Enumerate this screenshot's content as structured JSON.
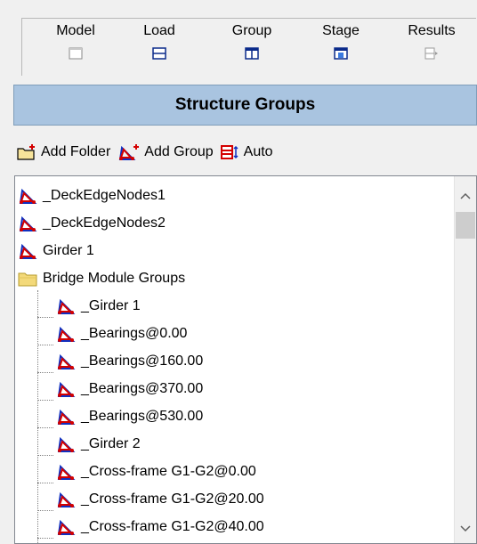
{
  "tabs": [
    {
      "label": "Model"
    },
    {
      "label": "Load"
    },
    {
      "label": "Group"
    },
    {
      "label": "Stage"
    },
    {
      "label": "Results"
    }
  ],
  "header": {
    "title": "Structure Groups"
  },
  "toolbar": {
    "add_folder": "Add Folder",
    "add_group": "Add Group",
    "auto": "Auto"
  },
  "tree": {
    "root_items": [
      "_DeckEdgeNodes1",
      "_DeckEdgeNodes2",
      "Girder 1"
    ],
    "folder": "Bridge Module Groups",
    "children": [
      "_Girder 1",
      "_Bearings@0.00",
      "_Bearings@160.00",
      "_Bearings@370.00",
      "_Bearings@530.00",
      "_Girder 2",
      "_Cross-frame G1-G2@0.00",
      "_Cross-frame G1-G2@20.00",
      "_Cross-frame G1-G2@40.00"
    ]
  },
  "colors": {
    "header_bg": "#a9c4e0",
    "group_icon_red": "#d40000",
    "group_icon_blue": "#1030c0",
    "folder_yellow": "#f3d97a"
  },
  "icons": {
    "group": "structure-group-icon",
    "folder": "folder-icon"
  }
}
